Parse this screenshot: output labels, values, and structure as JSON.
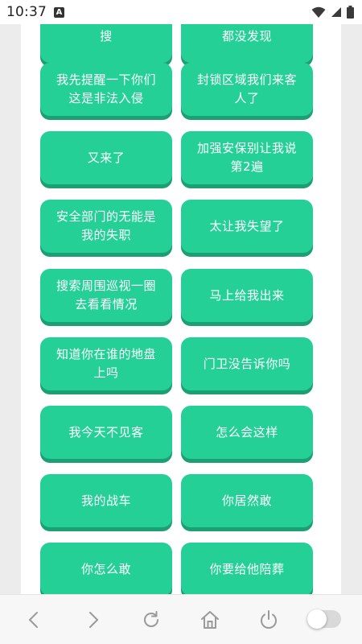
{
  "status_bar": {
    "time": "10:37",
    "notification_badge": "A",
    "icons": [
      "wifi-icon",
      "cell-signal-icon",
      "battery-icon"
    ]
  },
  "buttons": [
    {
      "label": "搜"
    },
    {
      "label": "都没发现"
    },
    {
      "label": "我先提醒一下你们这是非法入侵"
    },
    {
      "label": "封锁区域我们来客人了"
    },
    {
      "label": "又来了"
    },
    {
      "label": "加强安保别让我说第2遍"
    },
    {
      "label": "安全部门的无能是我的失职"
    },
    {
      "label": "太让我失望了"
    },
    {
      "label": "搜索周围巡视一圈去看看情况"
    },
    {
      "label": "马上给我出来"
    },
    {
      "label": "知道你在谁的地盘上吗"
    },
    {
      "label": "门卫没告诉你吗"
    },
    {
      "label": "我今天不见客"
    },
    {
      "label": "怎么会这样"
    },
    {
      "label": "我的战车"
    },
    {
      "label": "你居然敢"
    },
    {
      "label": "你怎么敢"
    },
    {
      "label": "你要给他陪葬"
    }
  ],
  "bottom_nav": {
    "items": [
      "back-icon",
      "forward-icon",
      "refresh-icon",
      "home-icon",
      "power-icon",
      "toggle-switch"
    ],
    "toggle_on": false
  },
  "colors": {
    "button": "#25d096",
    "button_shadow": "#1c9f72",
    "button_text": "#ffffff"
  }
}
